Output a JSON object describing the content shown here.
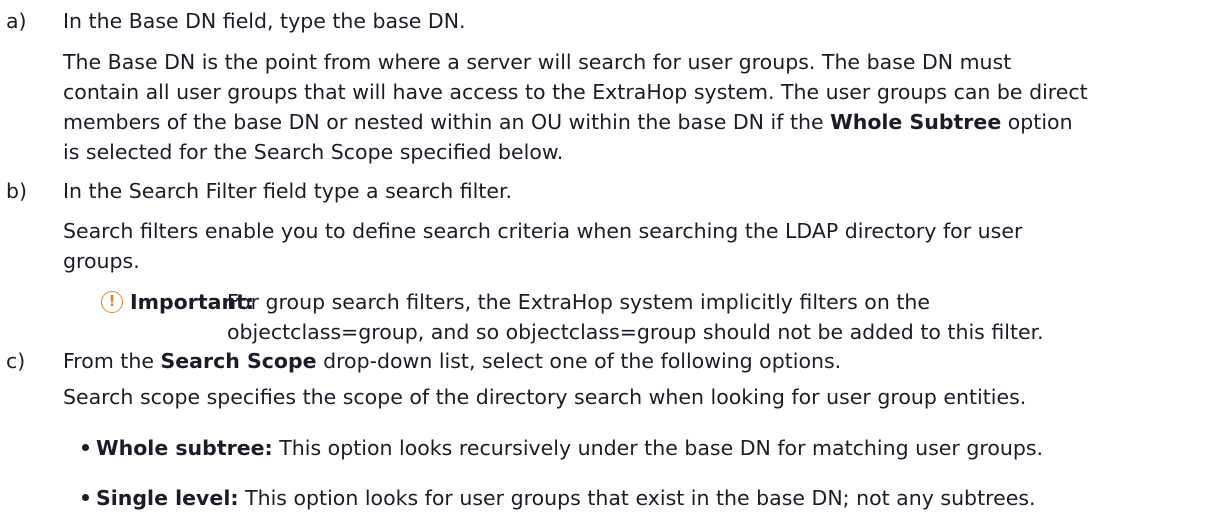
{
  "steps": [
    {
      "marker": "a)",
      "instruction": "In the Base DN field, type the base DN.",
      "explanation": {
        "line1": "The Base DN is the point from where a server will search for user groups. The base DN must",
        "line2": "contain all user groups that will have access to the ExtraHop system. The user groups can be direct",
        "line3_before": "members of the base DN or nested within an OU within the base DN if the ",
        "line3_bold": "Whole Subtree",
        "line3_after": " option",
        "line4": "is selected for the Search Scope specified below."
      }
    },
    {
      "marker": "b)",
      "instruction": "In the Search Filter field type a search filter.",
      "explanation": {
        "line1": "Search filters enable you to define search criteria when searching the LDAP directory for user",
        "line2": "groups."
      },
      "note": {
        "icon": "important-icon",
        "icon_glyph": "!",
        "label": "Important:",
        "line1": "For group search filters, the ExtraHop system implicitly filters on the",
        "line2": "objectclass=group, and so objectclass=group should not be added to this filter."
      }
    },
    {
      "marker": "c)",
      "instruction_before": "From the ",
      "instruction_bold": "Search Scope",
      "instruction_after": " drop-down list, select one of the following options.",
      "explanation": {
        "line1": "Search scope specifies the scope of the directory search when looking for user group entities."
      },
      "options": [
        {
          "label": "Whole subtree:",
          "text": " This option looks recursively under the base DN for matching user groups."
        },
        {
          "label": "Single level:",
          "text": " This option looks for user groups that exist in the base DN; not any subtrees."
        }
      ]
    }
  ],
  "colors": {
    "text": "#1c1c28",
    "important_accent": "#e8822a"
  }
}
